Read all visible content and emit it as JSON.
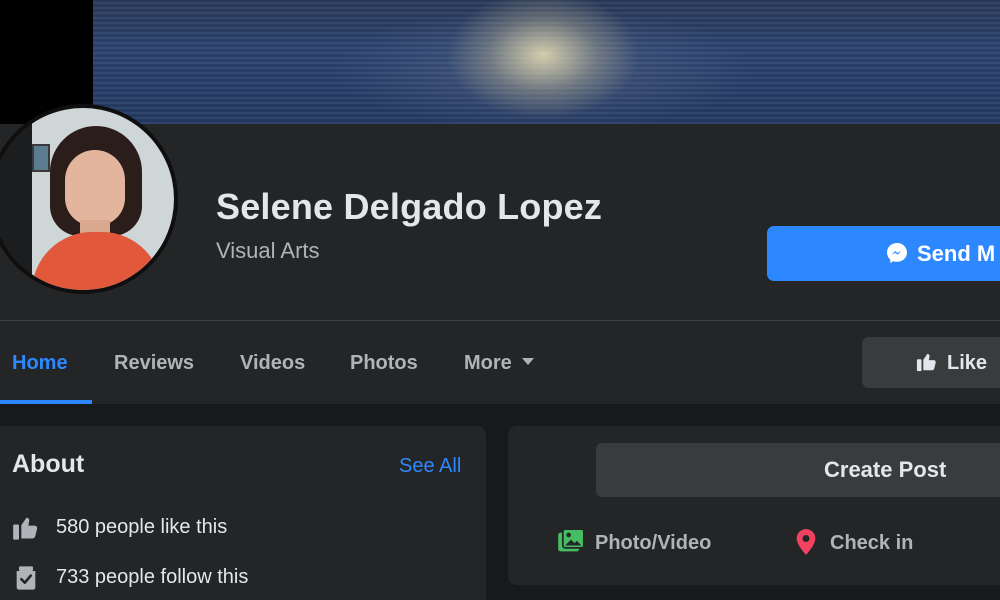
{
  "page": {
    "name": "Selene Delgado Lopez",
    "category": "Visual Arts"
  },
  "header": {
    "send_message_label": "Send M",
    "like_label": "Like"
  },
  "tabs": [
    {
      "label": "Home",
      "active": true
    },
    {
      "label": "Reviews"
    },
    {
      "label": "Videos"
    },
    {
      "label": "Photos"
    },
    {
      "label": "More"
    }
  ],
  "about": {
    "title": "About",
    "see_all": "See All",
    "likes_text": "580 people like this",
    "follows_text": "733 people follow this"
  },
  "composer": {
    "create_post_label": "Create Post",
    "actions": [
      {
        "label": "Photo/Video",
        "icon": "photo-video-icon",
        "color": "#45bd62"
      },
      {
        "label": "Check in",
        "icon": "location-pin-icon",
        "color": "#f3425f"
      }
    ]
  },
  "colors": {
    "accent": "#2d88ff",
    "background": "#18191a",
    "surface": "#242526",
    "button": "#3a3b3c"
  }
}
